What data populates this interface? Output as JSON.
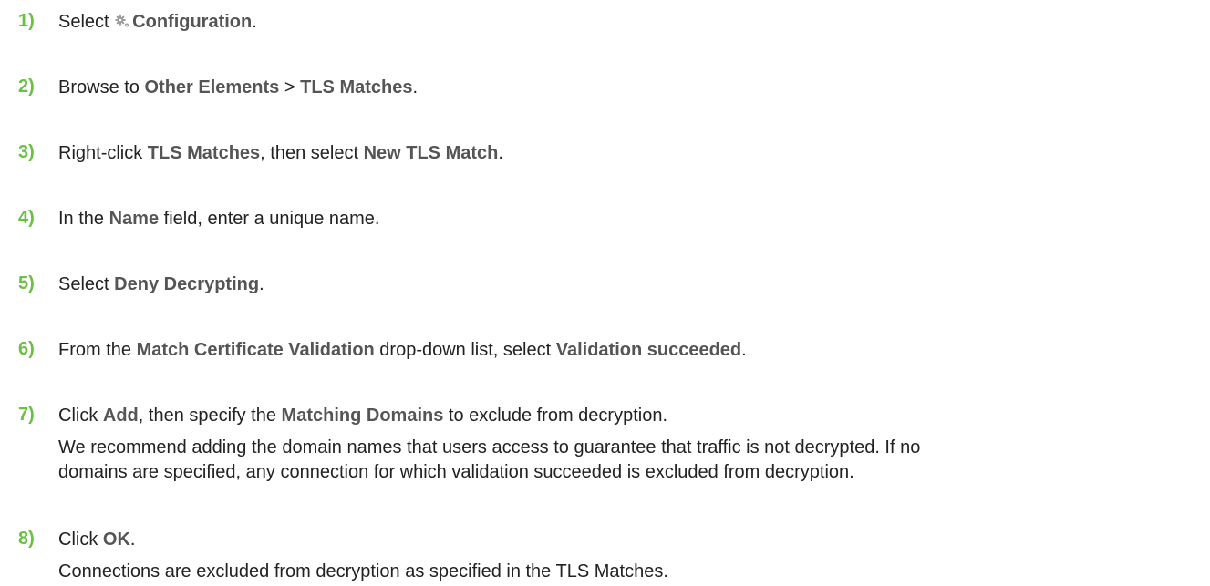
{
  "steps": [
    {
      "num": "1)",
      "parts": {
        "t1": "Select ",
        "icon": "gear-icon",
        "b1": "Configuration",
        "t2": "."
      }
    },
    {
      "num": "2)",
      "parts": {
        "t1": "Browse to ",
        "b1": "Other Elements",
        "t2": " > ",
        "b2": "TLS Matches",
        "t3": "."
      }
    },
    {
      "num": "3)",
      "parts": {
        "t1": "Right-click ",
        "b1": "TLS Matches",
        "t2": ", then select ",
        "b2": "New TLS Match",
        "t3": "."
      }
    },
    {
      "num": "4)",
      "parts": {
        "t1": "In the ",
        "b1": "Name",
        "t2": " field, enter a unique name."
      }
    },
    {
      "num": "5)",
      "parts": {
        "t1": "Select ",
        "b1": "Deny Decrypting",
        "t2": "."
      }
    },
    {
      "num": "6)",
      "parts": {
        "t1": "From the ",
        "b1": "Match Certificate Validation",
        "t2": " drop-down list, select ",
        "b2": "Validation succeeded",
        "t3": "."
      }
    },
    {
      "num": "7)",
      "parts": {
        "t1": "Click ",
        "b1": "Add",
        "t2": ", then specify the ",
        "b2": "Matching Domains",
        "t3": " to exclude from decryption."
      },
      "note_line1": "We recommend adding the domain names that users access to guarantee that traffic is not decrypted. If no",
      "note_line2": "domains are specified, any connection for which validation succeeded is excluded from decryption."
    },
    {
      "num": "8)",
      "parts": {
        "t1": "Click ",
        "b1": "OK",
        "t2": "."
      },
      "note_line1": "Connections are excluded from decryption as specified in the TLS Matches."
    }
  ]
}
